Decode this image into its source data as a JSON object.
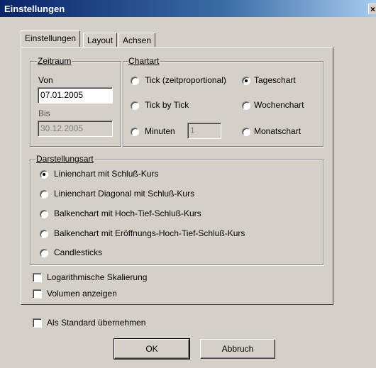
{
  "window": {
    "title": "Einstellungen",
    "close_glyph": "×"
  },
  "tabs": [
    {
      "label": "Einstellungen",
      "active": true
    },
    {
      "label": "Layout",
      "active": false
    },
    {
      "label": "Achsen",
      "active": false
    }
  ],
  "zeitraum": {
    "legend": "Zeitraum",
    "von_label": "Von",
    "von_value": "07.01.2005",
    "bis_label": "Bis",
    "bis_value": "30.12.2005"
  },
  "chartart": {
    "legend": "Chartart",
    "options": [
      {
        "label": "Tick (zeitproportional)",
        "checked": false
      },
      {
        "label": "Tageschart",
        "checked": true
      },
      {
        "label": "Tick by Tick",
        "checked": false
      },
      {
        "label": "Wochenchart",
        "checked": false
      },
      {
        "label": "Minuten",
        "checked": false
      },
      {
        "label": "Monatschart",
        "checked": false
      }
    ],
    "minuten_value": "1"
  },
  "darstellungsart": {
    "legend": "Darstellungsart",
    "options": [
      {
        "label": "Linienchart mit Schluß-Kurs",
        "checked": true
      },
      {
        "label": "Linienchart Diagonal mit Schluß-Kurs",
        "checked": false
      },
      {
        "label": "Balkenchart mit Hoch-Tief-Schluß-Kurs",
        "checked": false
      },
      {
        "label": "Balkenchart mit Eröffnungs-Hoch-Tief-Schluß-Kurs",
        "checked": false
      },
      {
        "label": "Candlesticks",
        "checked": false
      }
    ]
  },
  "checkboxes": {
    "log": "Logarithmische Skalierung",
    "volumen": "Volumen anzeigen",
    "standard": "Als Standard übernehmen"
  },
  "buttons": {
    "ok": "OK",
    "cancel": "Abbruch"
  }
}
